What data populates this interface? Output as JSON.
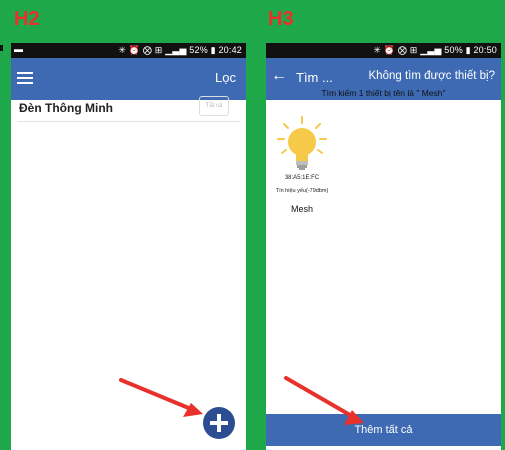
{
  "labels": {
    "h2": "H2",
    "h3": "H3"
  },
  "h2_screen": {
    "status": {
      "right": "✳ ⏰ ⨂ ⊞ ▁▃▅ 52% ▮ 20:42"
    },
    "appbar": {
      "filter_label": "Lọc"
    },
    "group": {
      "name": "Đèn Thông Minh",
      "toggle_label": "Tắt cả"
    }
  },
  "h3_screen": {
    "status": {
      "right": "✳ ⏰ ⨂ ⊞ ▁▃▅ 50% ▮ 20:50"
    },
    "appbar": {
      "back_icon": "back-arrow-icon",
      "title": "Tìm ...",
      "message": "Không tìm được thiết bị?"
    },
    "search_result_text": "Tìm kiếm 1 thiết bị tên là \" Mesh\"",
    "device": {
      "mac": "38:A5:1E:FC",
      "signal": "Tín hiệu yếu(-79dbm)",
      "name": "Mesh",
      "icon": "light-bulb-icon"
    },
    "add_all_label": "Thêm tất cả"
  },
  "colors": {
    "background": "#1fa84a",
    "appbar": "#3d6ab3",
    "fab": "#2d4d92",
    "arrow": "#e8312a",
    "label": "#e8312a",
    "bulb": "#f7c948"
  }
}
